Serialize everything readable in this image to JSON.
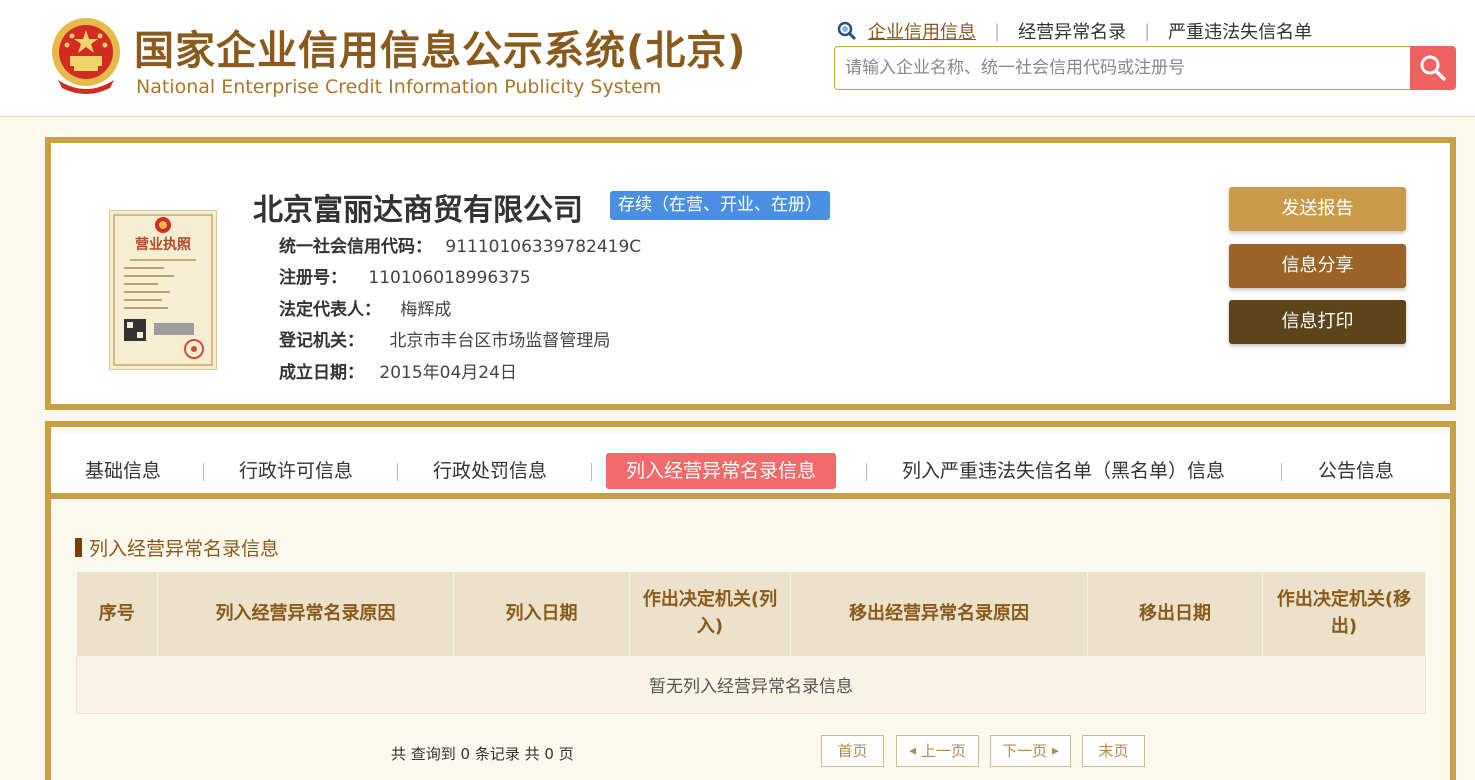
{
  "header": {
    "logo_cn": "国家企业信用信息公示系统(北京)",
    "logo_en": "National Enterprise Credit Information Publicity System",
    "nav": [
      "企业信用信息",
      "经营异常名录",
      "严重违法失信名单"
    ],
    "search_placeholder": "请输入企业名称、统一社会信用代码或注册号"
  },
  "company": {
    "name": "北京富丽达商贸有限公司",
    "status": "存续（在营、开业、在册）",
    "license_title": "营业执照",
    "fields": [
      {
        "label": "统一社会信用代码：",
        "value": "91110106339782419C"
      },
      {
        "label": "注册号：",
        "value": "110106018996375"
      },
      {
        "label": "法定代表人：",
        "value": "梅辉成"
      },
      {
        "label": "登记机关：",
        "value": "北京市丰台区市场监督管理局"
      },
      {
        "label": "成立日期：",
        "value": "2015年04月24日"
      }
    ],
    "buttons": [
      "发送报告",
      "信息分享",
      "信息打印"
    ]
  },
  "tabs": [
    "基础信息",
    "行政许可信息",
    "行政处罚信息",
    "列入经营异常名录信息",
    "列入严重违法失信名单（黑名单）信息",
    "公告信息"
  ],
  "section": {
    "title": "列入经营异常名录信息",
    "columns": [
      "序号",
      "列入经营异常名录原因",
      "列入日期",
      "作出决定机关(列入)",
      "移出经营异常名录原因",
      "移出日期",
      "作出决定机关(移出)"
    ],
    "empty_text": "暂无列入经营异常名录信息"
  },
  "pager": {
    "info": "共 查询到 0 条记录 共 0 页",
    "first": "首页",
    "prev": "上一页",
    "next": "下一页",
    "last": "末页"
  },
  "colors": {
    "gold": "#c9a043",
    "brown": "#8a5a1c",
    "active_tab": "#f26b6b",
    "status_blue": "#4a90e2",
    "btn_report": "#c89a4a",
    "btn_share": "#9a6426",
    "btn_print": "#5e441a"
  }
}
